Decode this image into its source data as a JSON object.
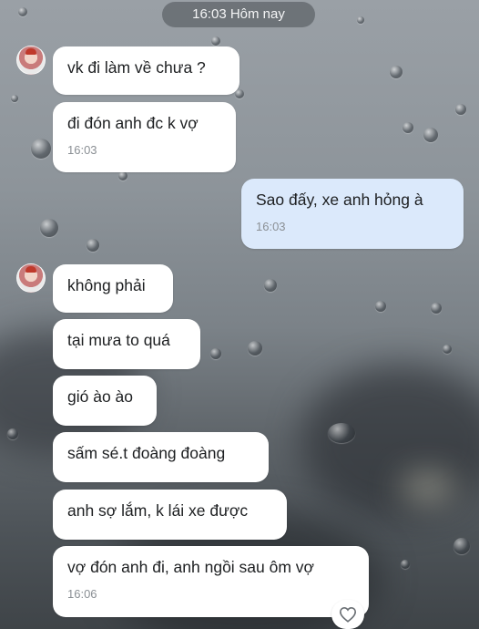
{
  "header": {
    "time_pill": "16:03 Hôm nay"
  },
  "messages": [
    {
      "text": "vk đi làm về chưa ?"
    },
    {
      "text": "đi đón anh đc k vợ",
      "time": "16:03"
    },
    {
      "text": "Sao đấy, xe anh hỏng à",
      "time": "16:03"
    },
    {
      "text": "không phải"
    },
    {
      "text": "tại mưa to quá"
    },
    {
      "text": "gió ào ào"
    },
    {
      "text": "sấm sé.t đoàng đoàng"
    },
    {
      "text": "anh sợ lắm, k lái xe được"
    },
    {
      "text": "vợ đón anh đi, anh ngồi sau ôm vợ",
      "time": "16:06"
    }
  ],
  "reaction": {
    "icon": "heart-outline-icon"
  }
}
